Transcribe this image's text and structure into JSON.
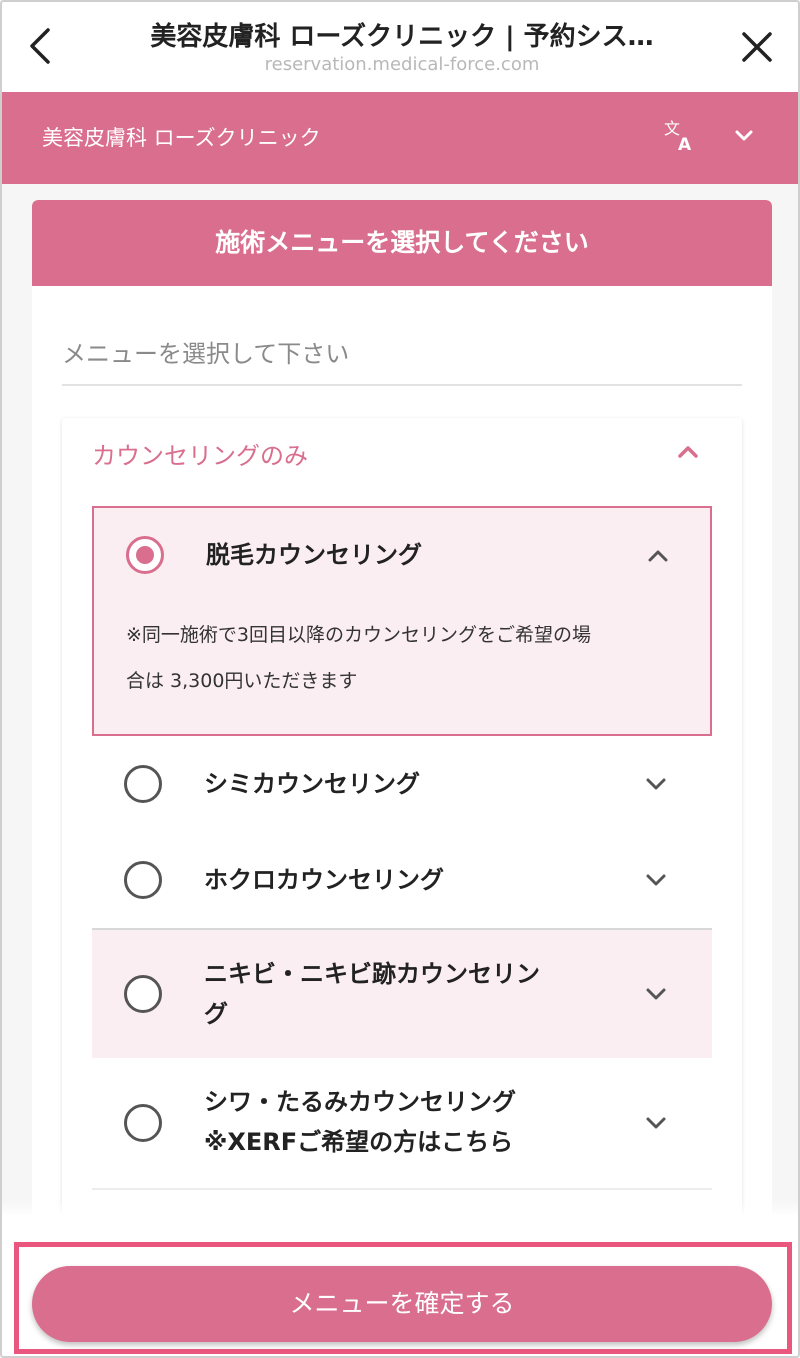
{
  "browser": {
    "title": "美容皮膚科 ローズクリニック | 予約シス…",
    "url": "reservation.medical-force.com",
    "back_icon": "chevron-left-icon",
    "close_icon": "close-icon"
  },
  "clinic": {
    "name": "美容皮膚科 ローズクリニック",
    "translate_icon": "translate-icon",
    "lang_icon": "chevron-down-icon"
  },
  "menu_card": {
    "header": "施術メニューを選択してください",
    "select_placeholder": "メニューを選択して下さい",
    "group": {
      "title": "カウンセリングのみ",
      "expanded": true,
      "items": [
        {
          "label": "脱毛カウンセリング",
          "selected": true,
          "expanded": true,
          "note_line1": "※同一施術で3回目以降のカウンセリングをご希望の場",
          "note_line2": "合は 3,300円いただきます"
        },
        {
          "label": "シミカウンセリング",
          "selected": false,
          "expanded": false
        },
        {
          "label": "ホクロカウンセリング",
          "selected": false,
          "expanded": false
        },
        {
          "label_line1": "ニキビ・ニキビ跡カウンセリン",
          "label_line2": "グ",
          "selected": false,
          "expanded": false
        },
        {
          "label_line1": "シワ・たるみカウンセリング",
          "label_line2": "※XERFご希望の方はこちら",
          "selected": false,
          "expanded": false
        }
      ]
    }
  },
  "footer": {
    "confirm_label": "メニューを確定する"
  },
  "colors": {
    "brand": "#d96e8e",
    "highlight": "#e9577f",
    "selected_bg": "#fbeef2"
  }
}
